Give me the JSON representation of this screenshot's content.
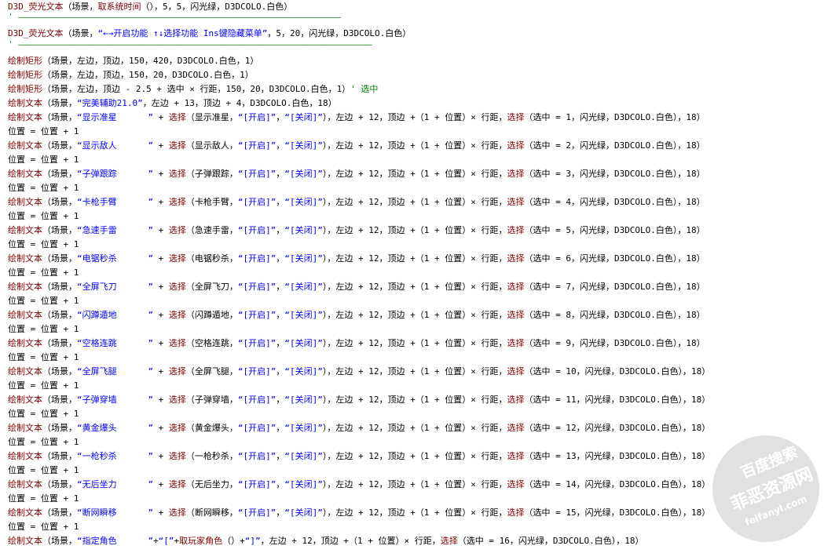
{
  "code_lines": [
    {
      "kind": "line",
      "cls": "l1",
      "segs": [
        [
          "kw",
          "D3D_荧光文本"
        ],
        [
          "",
          "（场景，"
        ],
        [
          "kw",
          "取系统时间"
        ],
        [
          "",
          "（），5，5，闪光绿，D3DCOLO.白色）"
        ]
      ]
    },
    {
      "kind": "sep",
      "segs": [
        [
          "cmt",
          "' ——————————————————————————————————————————————————————————————"
        ]
      ]
    },
    {
      "kind": "line",
      "cls": "",
      "segs": [
        [
          "kw",
          "D3D_荧光文本"
        ],
        [
          "",
          "（场景，"
        ],
        [
          "str",
          "“←→开启功能 ↑↓选择功能 Ins键隐藏菜单”"
        ],
        [
          "",
          "，5，20，闪光绿，D3DCOLO.白色）"
        ]
      ]
    },
    {
      "kind": "sep",
      "segs": [
        [
          "cmt",
          "' ————————————————————————————————————————————————————————————————————"
        ]
      ]
    },
    {
      "kind": "line",
      "cls": "",
      "segs": [
        [
          "kw",
          "绘制矩形"
        ],
        [
          "",
          "（场景，左边，顶边，150，420，D3DCOLO.白色，1）"
        ]
      ]
    },
    {
      "kind": "line",
      "cls": "",
      "segs": [
        [
          "kw",
          "绘制矩形"
        ],
        [
          "",
          "（场景，左边，顶边，150，20，D3DCOLO.白色，1）"
        ]
      ]
    },
    {
      "kind": "line",
      "cls": "",
      "segs": [
        [
          "kw",
          "绘制矩形"
        ],
        [
          "",
          "（场景，左边，顶边 - 2.5 + 选中 × 行距，150，20，D3DCOLO.白色，1）"
        ],
        [
          "cmt",
          "' 选中"
        ]
      ]
    },
    {
      "kind": "line",
      "cls": "",
      "segs": [
        [
          "kw",
          "绘制文本"
        ],
        [
          "",
          "（场景，"
        ],
        [
          "str",
          "“完美辅助21.0”"
        ],
        [
          "",
          "，左边 + 13，顶边 + 4，D3DCOLO.白色，18）"
        ]
      ]
    },
    {
      "kind": "item",
      "name": "显示准星",
      "sel": "1"
    },
    {
      "kind": "item",
      "name": "显示敌人",
      "sel": "2"
    },
    {
      "kind": "item",
      "name": "子弹跟踪",
      "sel": "3"
    },
    {
      "kind": "item",
      "name": "卡枪手臂",
      "sel": "4"
    },
    {
      "kind": "item",
      "name": "急速手雷",
      "sel": "5"
    },
    {
      "kind": "item",
      "name": "电锯秒杀",
      "sel": "6"
    },
    {
      "kind": "item",
      "name": "全屏飞刀",
      "sel": "7"
    },
    {
      "kind": "item",
      "name": "闪蹲遁地",
      "sel": "8"
    },
    {
      "kind": "item",
      "name": "空格连跳",
      "sel": "9"
    },
    {
      "kind": "item",
      "name": "全屏飞腿",
      "sel": "10"
    },
    {
      "kind": "item",
      "name": "子弹穿墙",
      "sel": "11"
    },
    {
      "kind": "item",
      "name": "黄金爆头",
      "sel": "12"
    },
    {
      "kind": "item",
      "name": "一枪秒杀",
      "sel": "13"
    },
    {
      "kind": "item",
      "name": "无后坐力",
      "sel": "14"
    },
    {
      "kind": "item",
      "name": "断网瞬移",
      "sel": "15"
    },
    {
      "kind": "line",
      "cls": "",
      "segs": [
        [
          "kw",
          "绘制文本"
        ],
        [
          "",
          "（场景，"
        ],
        [
          "str",
          "“指定角色      ”"
        ],
        [
          "",
          "+"
        ],
        [
          "str",
          "“[”"
        ],
        [
          "",
          "+"
        ],
        [
          "kw",
          "取玩家角色"
        ],
        [
          "",
          "（）+"
        ],
        [
          "str",
          "“]”"
        ],
        [
          "",
          "，左边 + 12，顶边 +（1 + 位置）× 行距，"
        ],
        [
          "kw",
          "选择"
        ],
        [
          "",
          "（选中 = 16，闪光绿，D3DCOLO.白色），18）"
        ]
      ]
    }
  ],
  "watermark": {
    "line1": "百度搜索",
    "line2": "菲恶资源网",
    "line3": "feifanyl.com"
  }
}
